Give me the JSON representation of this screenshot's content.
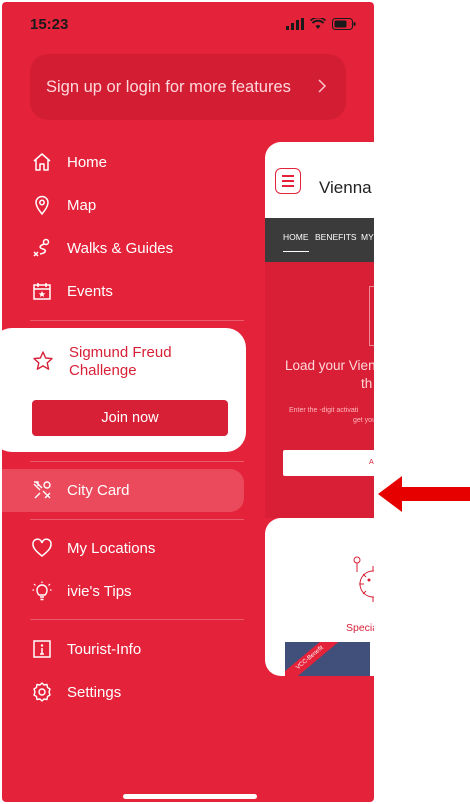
{
  "status_bar": {
    "time": "15:23"
  },
  "login_banner": {
    "label": "Sign up or login for more features"
  },
  "menu": {
    "home": "Home",
    "map": "Map",
    "walks": "Walks & Guides",
    "events": "Events",
    "city_card": "City Card",
    "my_locations": "My Locations",
    "tips": "ivie's Tips",
    "tourist_info": "Tourist-Info",
    "settings": "Settings"
  },
  "challenge": {
    "title": "Sigmund Freud Challenge",
    "button": "Join now"
  },
  "preview": {
    "title": "Vienna",
    "nav": [
      "HOME",
      "BENEFITS",
      "MY"
    ],
    "load_line1": "Load your Vien",
    "load_line2": "th",
    "enter_line1": "Enter the -digit activati",
    "enter_line2": "get your r",
    "input_text": "A",
    "special": "Specia",
    "ribbon": "VCC-Benefit"
  },
  "colors": {
    "primary_red": "#e4233a",
    "arrow_red": "#e60000"
  }
}
